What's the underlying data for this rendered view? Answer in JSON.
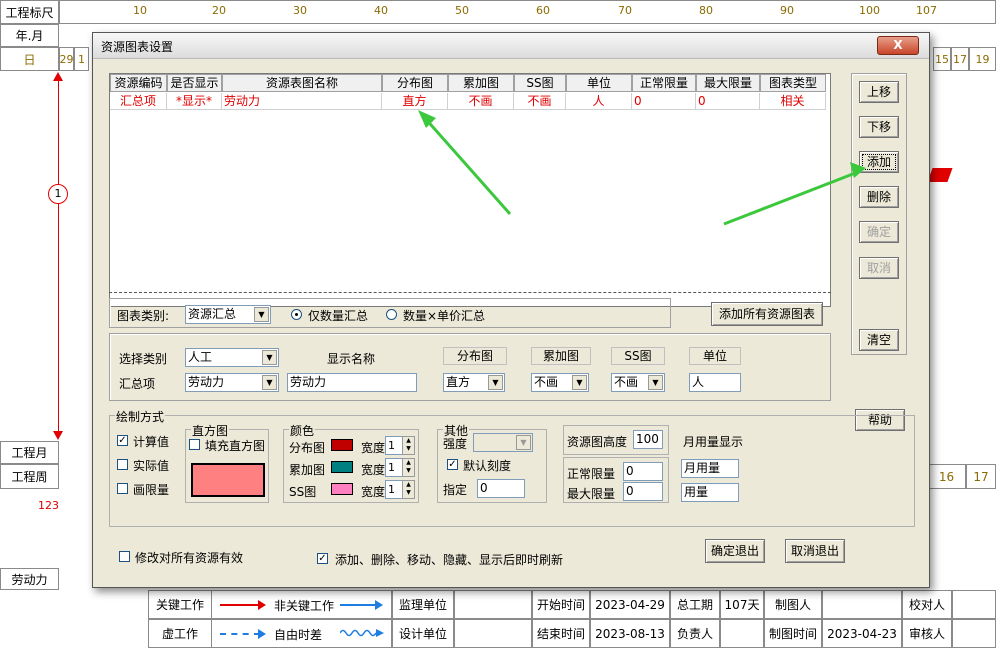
{
  "background": {
    "top_labels": [
      "工程标尺",
      "年.月",
      "日"
    ],
    "ruler_numbers": [
      "10",
      "20",
      "30",
      "40",
      "50",
      "60",
      "70",
      "80",
      "90",
      "100",
      "107"
    ],
    "day_left": [
      "29",
      "1"
    ],
    "day_right": [
      "15",
      "17",
      "19"
    ],
    "node_label": "1",
    "left_labels": {
      "month": "工程月",
      "week": "工程周",
      "count": "123",
      "labor": "劳动力"
    },
    "week_right": [
      "16",
      "17"
    ],
    "legend": {
      "critical": "关键工作",
      "non_critical": "非关键工作",
      "virtual": "虚工作",
      "free_float": "自由时差",
      "supervisor": "监理单位",
      "designer": "设计单位",
      "start_label": "开始时间",
      "start_value": "2023-04-29",
      "end_label": "结束时间",
      "end_value": "2023-08-13",
      "duration_label": "总工期",
      "duration_value": "107天",
      "owner_label": "负责人",
      "drawer_label": "制图人",
      "draw_time_label": "制图时间",
      "draw_time_value": "2023-04-23",
      "checker_label": "校对人",
      "reviewer_label": "审核人"
    },
    "colors": {
      "critical_line": "#e00000",
      "normal_line": "#1e7de0",
      "ruler_text": "#8b6b00"
    }
  },
  "dialog": {
    "title": "资源图表设置",
    "close_label": "X",
    "table": {
      "columns": [
        "资源编码",
        "是否显示",
        "资源表图名称",
        "分布图",
        "累加图",
        "SS图",
        "单位",
        "正常限量",
        "最大限量",
        "图表类型"
      ],
      "rows": [
        [
          "汇总项",
          "*显示*",
          "劳动力",
          "直方",
          "不画",
          "不画",
          "人",
          "0",
          "0",
          "相关"
        ]
      ]
    },
    "side_buttons": {
      "up": "上移",
      "down": "下移",
      "add": "添加",
      "delete": "删除",
      "confirm": "确定",
      "cancel": "取消",
      "clear": "清空",
      "help": "帮助"
    },
    "chart_type_label": "图表类别:",
    "chart_type_value": "资源汇总",
    "radio_qty_only": "仅数量汇总",
    "radio_qty_price": "数量×单价汇总",
    "add_all_button": "添加所有资源图表",
    "select_category_label": "选择类别",
    "select_category_value": "人工",
    "summary_item_label": "汇总项",
    "summary_item_value": "劳动力",
    "display_name_label": "显示名称",
    "display_name_value": "劳动力",
    "dist_label": "分布图",
    "dist_value": "直方",
    "accum_label": "累加图",
    "accum_value": "不画",
    "ss_label": "SS图",
    "ss_value": "不画",
    "unit_label": "单位",
    "unit_value": "人",
    "draw_mode": {
      "title": "绘制方式",
      "calc_value": "计算值",
      "actual_value": "实际值",
      "draw_limit": "画限量",
      "histogram_title": "直方图",
      "fill_histogram": "填充直方图",
      "histogram_color": "#ff8080",
      "color_title": "颜色",
      "dist_color_label": "分布图",
      "accum_color_label": "累加图",
      "ss_color_label": "SS图",
      "width_label": "宽度",
      "width_value": "1",
      "dist_color": "#c00000",
      "accum_color": "#008080",
      "ss_color": "#ff80c0",
      "other_title": "其他",
      "intensity_label": "强度",
      "default_scale": "默认刻度",
      "specify_label": "指定",
      "specify_value": "0"
    },
    "height_label": "资源图高度",
    "height_value": "100",
    "monthly_label": "月用量显示",
    "normal_limit_label": "正常限量",
    "normal_limit_value": "0",
    "max_limit_label": "最大限量",
    "max_limit_value": "0",
    "monthly_usage": "月用量",
    "usage": "用量",
    "modify_all_label": "修改对所有资源有效",
    "refresh_label": "添加、删除、移动、隐藏、显示后即时刷新",
    "ok_exit": "确定退出",
    "cancel_exit": "取消退出",
    "arrow_color": "#3cc83c"
  }
}
